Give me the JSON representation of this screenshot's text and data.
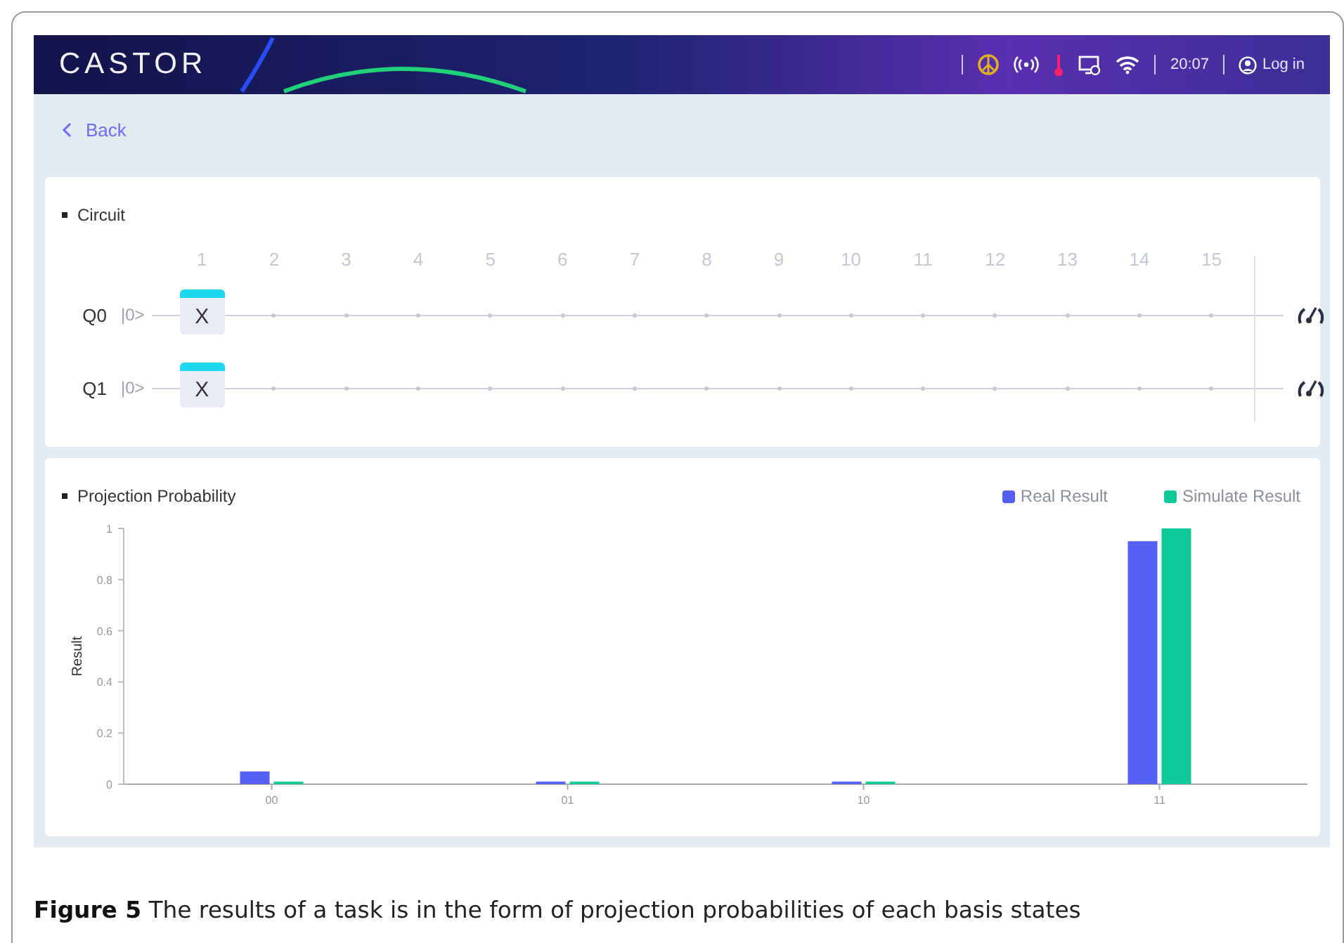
{
  "header": {
    "logo": "CASTOR",
    "time": "20:07",
    "login": "Log in"
  },
  "nav": {
    "back": "Back"
  },
  "circuit": {
    "title": "Circuit",
    "columns": [
      "1",
      "2",
      "3",
      "4",
      "5",
      "6",
      "7",
      "8",
      "9",
      "10",
      "11",
      "12",
      "13",
      "14",
      "15"
    ],
    "qubits": [
      {
        "name": "Q0",
        "state": "|0>",
        "slots": [
          {
            "kind": "gate",
            "label": "X"
          },
          {
            "kind": "empty"
          },
          {
            "kind": "empty"
          },
          {
            "kind": "empty"
          },
          {
            "kind": "empty"
          },
          {
            "kind": "empty"
          },
          {
            "kind": "empty"
          },
          {
            "kind": "empty"
          },
          {
            "kind": "empty"
          },
          {
            "kind": "empty"
          },
          {
            "kind": "empty"
          },
          {
            "kind": "empty"
          },
          {
            "kind": "empty"
          },
          {
            "kind": "empty"
          },
          {
            "kind": "empty"
          }
        ]
      },
      {
        "name": "Q1",
        "state": "|0>",
        "slots": [
          {
            "kind": "gate",
            "label": "X"
          },
          {
            "kind": "empty"
          },
          {
            "kind": "empty"
          },
          {
            "kind": "empty"
          },
          {
            "kind": "empty"
          },
          {
            "kind": "empty"
          },
          {
            "kind": "empty"
          },
          {
            "kind": "empty"
          },
          {
            "kind": "empty"
          },
          {
            "kind": "empty"
          },
          {
            "kind": "empty"
          },
          {
            "kind": "empty"
          },
          {
            "kind": "empty"
          },
          {
            "kind": "empty"
          },
          {
            "kind": "empty"
          }
        ]
      }
    ]
  },
  "results": {
    "title": "Projection Probability",
    "chart_data": {
      "type": "bar",
      "ylabel": "Result",
      "categories": [
        "00",
        "01",
        "10",
        "11"
      ],
      "ylim": [
        0,
        1
      ],
      "yticks": [
        0,
        0.2,
        0.4,
        0.6,
        0.8,
        1
      ],
      "series": [
        {
          "name": "Real Result",
          "color": "#5560f5",
          "values": [
            0.05,
            0.01,
            0.01,
            0.95
          ]
        },
        {
          "name": "Simulate Result",
          "color": "#10c89a",
          "values": [
            0.01,
            0.01,
            0.01,
            1.0
          ]
        }
      ]
    }
  },
  "caption": "**Figure 5**  The results of a task is in the form of projection probabilities of each basis states"
}
